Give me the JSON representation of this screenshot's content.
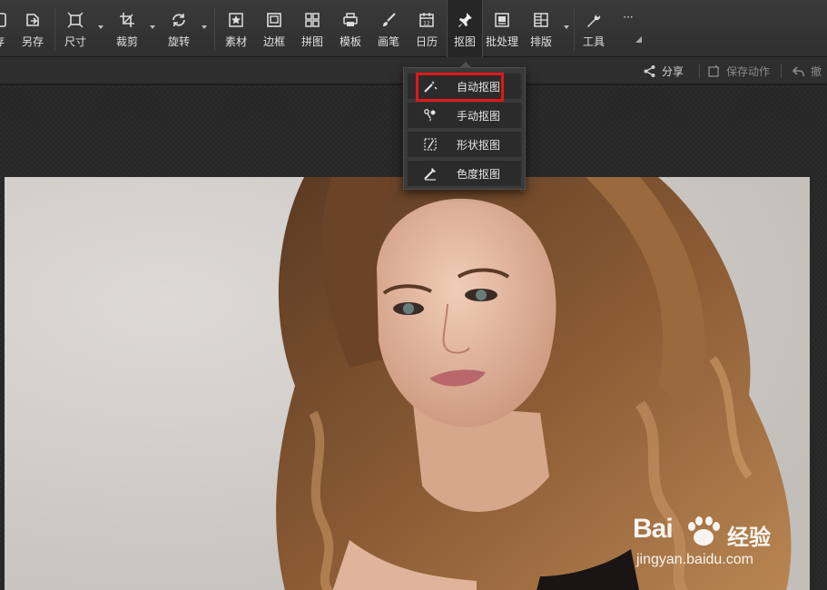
{
  "toolbar": {
    "tools": [
      {
        "id": "save",
        "label": "存",
        "icon": "save-icon"
      },
      {
        "id": "save-as",
        "label": "另存",
        "icon": "save-as-icon"
      },
      {
        "id": "size",
        "label": "尺寸",
        "icon": "resize-icon"
      },
      {
        "id": "crop",
        "label": "裁剪",
        "icon": "crop-icon"
      },
      {
        "id": "rotate",
        "label": "旋转",
        "icon": "rotate-icon"
      },
      {
        "id": "material",
        "label": "素材",
        "icon": "star-icon"
      },
      {
        "id": "border",
        "label": "边框",
        "icon": "frame-icon"
      },
      {
        "id": "collage",
        "label": "拼图",
        "icon": "grid-icon"
      },
      {
        "id": "template",
        "label": "模板",
        "icon": "printer-icon"
      },
      {
        "id": "brush",
        "label": "画笔",
        "icon": "brush-icon"
      },
      {
        "id": "calendar",
        "label": "日历",
        "icon": "calendar-icon",
        "day": "12"
      },
      {
        "id": "cutout",
        "label": "抠图",
        "icon": "pin-icon",
        "active": true
      },
      {
        "id": "batch",
        "label": "批处理",
        "icon": "batch-icon"
      },
      {
        "id": "layout",
        "label": "排版",
        "icon": "layout-icon"
      },
      {
        "id": "tools",
        "label": "工具",
        "icon": "wrench-icon"
      },
      {
        "id": "more",
        "label": "···",
        "icon": "more-icon"
      }
    ]
  },
  "subbar": {
    "share": "分享",
    "save_action": "保存动作",
    "undo": "撤"
  },
  "cutout_menu": {
    "items": [
      {
        "label": "自动抠图",
        "icon": "magic-wand-icon",
        "highlighted": true
      },
      {
        "label": "手动抠图",
        "icon": "manual-brush-icon"
      },
      {
        "label": "形状抠图",
        "icon": "shape-select-icon"
      },
      {
        "label": "色度抠图",
        "icon": "color-pick-icon"
      }
    ]
  },
  "watermark": {
    "brand": "Bai",
    "brand_cn": "经验",
    "url": "jingyan.baidu.com"
  },
  "colors": {
    "toolbar_bg": "#333333",
    "menu_bg": "#2b2b2b",
    "highlight": "#e01818"
  }
}
